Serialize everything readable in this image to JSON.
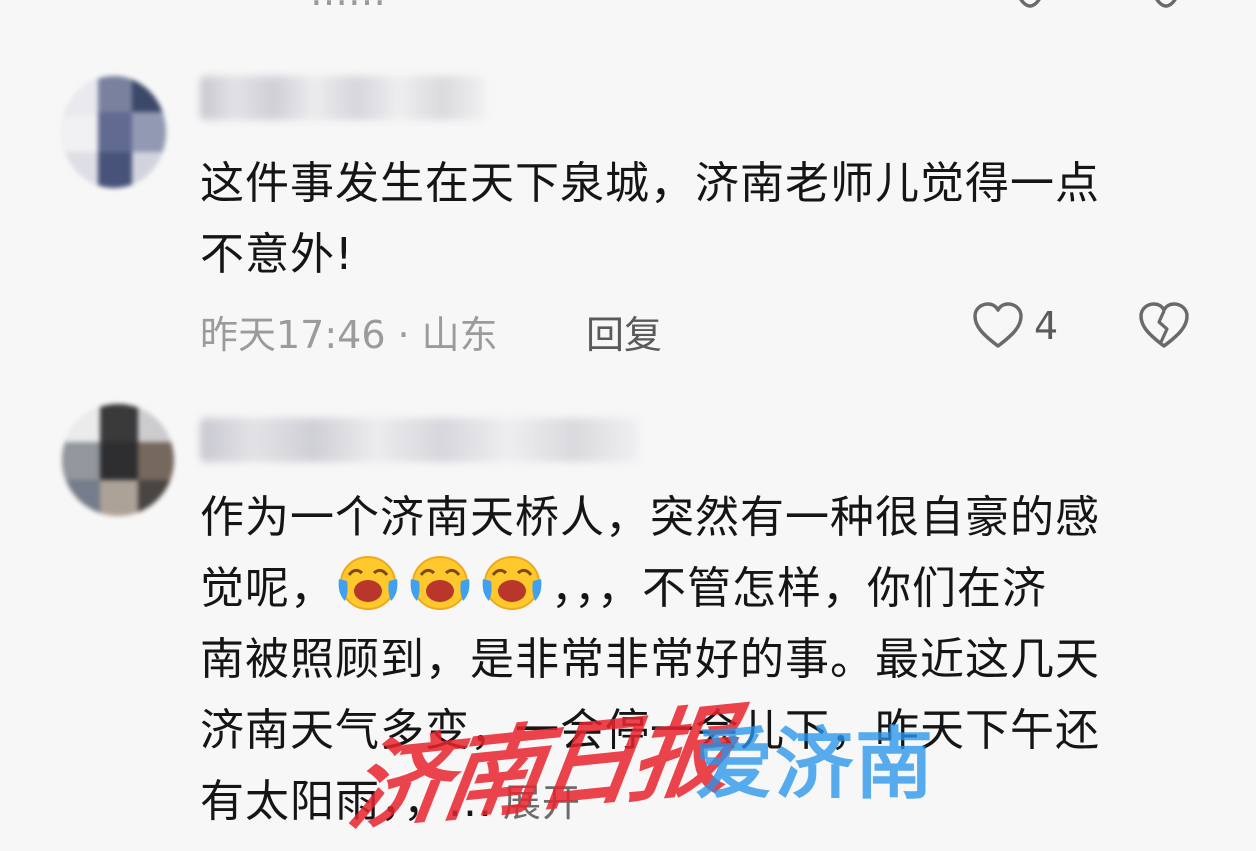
{
  "top_partial": {
    "text": "……",
    "like_icon": "heart-outline-icon",
    "dislike_icon": "broken-heart-icon"
  },
  "comments": [
    {
      "avatar_icon": "avatar-blurred",
      "username": "",
      "text_lines": [
        "这件事发生在天下泉城，济南老师儿觉得一点",
        "不意外!"
      ],
      "time": "昨天17:46",
      "separator": "·",
      "location": "山东",
      "reply_label": "回复",
      "like_icon": "heart-outline-icon",
      "like_count": "4",
      "dislike_icon": "broken-heart-icon"
    },
    {
      "avatar_icon": "avatar-blurred",
      "username": "",
      "text_lines": [
        "作为一个济南天桥人，突然有一种很自豪的感",
        "，，，不管怎样，你们在济",
        "南被照顾到，是非常非常好的事。最近这几天",
        "济南天气多变，一会停一会儿下，昨天下午还",
        "有太阳雨，，..."
      ],
      "line2_prefix": "觉呢，",
      "emojis": [
        "laughing-crying-emoji",
        "laughing-crying-emoji",
        "laughing-crying-emoji"
      ],
      "expand_label": "展开"
    }
  ],
  "watermark": {
    "paper_name": "济南日报",
    "brand_name": "爱济南"
  },
  "colors": {
    "background": "#f7f7f7",
    "text": "#151515",
    "meta": "#9b9b9b",
    "action": "#5a5a5a",
    "watermark_red": "#e8232d",
    "watermark_blue": "#2896eb"
  }
}
